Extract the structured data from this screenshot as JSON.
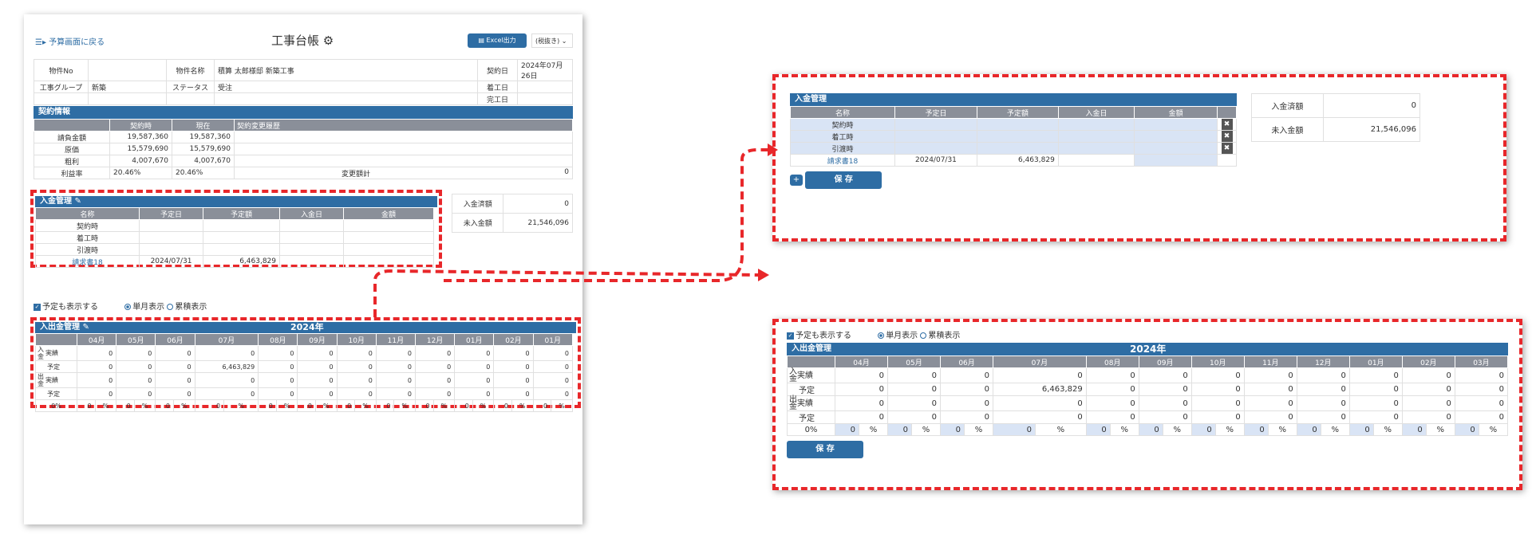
{
  "left": {
    "back_link": "予算画面に戻る",
    "title": "工事台帳",
    "excel_button": "Excel出力",
    "dropdown": "(税抜き)",
    "info": {
      "bukken_no_label": "物件No",
      "bukken_no": "",
      "bukken_name_label": "物件名称",
      "bukken_name": "積算 太郎様邸 新築工事",
      "contract_date_label": "契約日",
      "contract_date": "2024年07月26日",
      "group_label": "工事グループ",
      "group": "新築",
      "status_label": "ステータス",
      "status": "受注",
      "start_label": "着工日",
      "start": "",
      "done_label": "完工日",
      "done": ""
    },
    "contract": {
      "header": "契約情報",
      "cols": [
        "",
        "契約時",
        "現在",
        "契約変更履歴"
      ],
      "rows": [
        [
          "請負金額",
          "19,587,360",
          "19,587,360"
        ],
        [
          "原価",
          "15,579,690",
          "15,579,690"
        ],
        [
          "粗利",
          "4,007,670",
          "4,007,670"
        ]
      ],
      "rate_label": "利益率",
      "rate1": "20.46%",
      "rate2": "20.46%",
      "total_label": "変更額計",
      "total": "0"
    },
    "nyukin": {
      "header": "入金管理",
      "cols": [
        "名称",
        "予定日",
        "予定額",
        "入金日",
        "金額"
      ],
      "rows": [
        [
          "契約時",
          "",
          ""
        ],
        [
          "着工時",
          "",
          ""
        ],
        [
          "引渡時",
          "",
          ""
        ]
      ],
      "invoice": {
        "name": "請求書18",
        "date": "2024/07/31",
        "amount": "6,463,829"
      }
    },
    "summary": {
      "paid_label": "入金済額",
      "paid": "0",
      "unpaid_label": "未入金額",
      "unpaid": "21,546,096"
    },
    "options": {
      "show_plan": "予定も表示する",
      "single": "単月表示",
      "cumulative": "累積表示"
    },
    "cash": {
      "header": "入出金管理",
      "year": "2024年"
    }
  },
  "right_top": {
    "header": "入金管理",
    "cols": [
      "名称",
      "予定日",
      "予定額",
      "入金日",
      "金額"
    ],
    "rows": [
      "契約時",
      "着工時",
      "引渡時"
    ],
    "invoice": {
      "name": "請求書18",
      "date": "2024/07/31",
      "amount": "6,463,829"
    },
    "add": "+",
    "save": "保 存",
    "paid_label": "入金済額",
    "paid": "0",
    "unpaid_label": "未入金額",
    "unpaid": "21,546,096"
  },
  "right_bottom": {
    "show_plan": "予定も表示する",
    "single": "単月表示",
    "cumulative": "累積表示",
    "header": "入出金管理",
    "year": "2024年",
    "save": "保 存"
  },
  "months_left": [
    "04月",
    "05月",
    "06月",
    "07月",
    "08月",
    "09月",
    "10月",
    "11月",
    "12月",
    "01月",
    "02月",
    "01月"
  ],
  "months_right": [
    "04月",
    "05月",
    "06月",
    "07月",
    "08月",
    "09月",
    "10月",
    "11月",
    "12月",
    "01月",
    "02月",
    "03月"
  ],
  "cash_rows": {
    "in_label": "入金",
    "out_label": "出金",
    "actual": "実績",
    "plan": "予定",
    "pct_label": "0%",
    "pct_unit": "%",
    "in_actual": [
      "0",
      "0",
      "0",
      "0",
      "0",
      "0",
      "0",
      "0",
      "0",
      "0",
      "0",
      "0"
    ],
    "in_plan": [
      "0",
      "0",
      "0",
      "6,463,829",
      "0",
      "0",
      "0",
      "0",
      "0",
      "0",
      "0",
      "0"
    ],
    "out_actual": [
      "0",
      "0",
      "0",
      "0",
      "0",
      "0",
      "0",
      "0",
      "0",
      "0",
      "0",
      "0"
    ],
    "out_plan": [
      "0",
      "0",
      "0",
      "0",
      "0",
      "0",
      "0",
      "0",
      "0",
      "0",
      "0",
      "0"
    ],
    "pct": [
      "0",
      "0",
      "0",
      "0",
      "0",
      "0",
      "0",
      "0",
      "0",
      "0",
      "0",
      "0"
    ]
  }
}
